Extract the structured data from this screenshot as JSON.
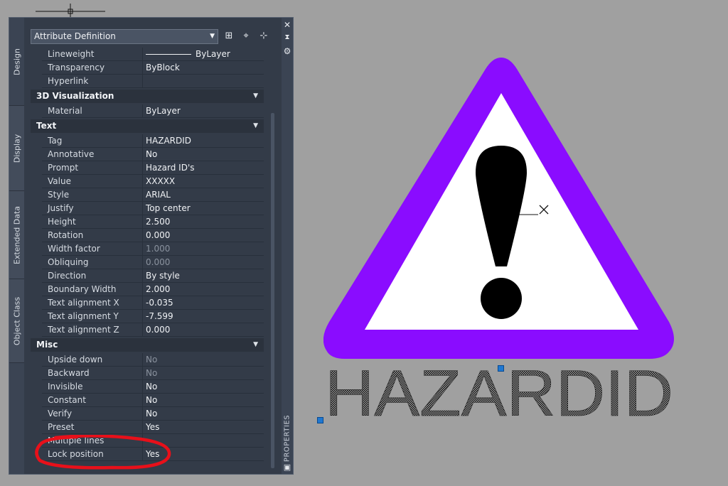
{
  "selector": {
    "value": "Attribute Definition"
  },
  "vertical_tabs": [
    "Design",
    "Display",
    "Extended Data",
    "Object Class"
  ],
  "right_bar_label": "PROPERTIES",
  "icons": {
    "close": "close-icon",
    "autohide": "autohide-icon",
    "settings": "settings-icon",
    "quick_select": "quick-select-icon",
    "select_objects": "select-objects-icon",
    "toggle_pickadd": "toggle-pickadd-icon",
    "properties_palette": "properties-palette-icon"
  },
  "sections": {
    "general_rows": [
      {
        "name": "Lineweight",
        "value": "ByLayer",
        "line": true
      },
      {
        "name": "Transparency",
        "value": "ByBlock"
      },
      {
        "name": "Hyperlink",
        "value": ""
      }
    ],
    "visualization": {
      "title": "3D Visualization",
      "rows": [
        {
          "name": "Material",
          "value": "ByLayer"
        }
      ]
    },
    "text": {
      "title": "Text",
      "rows": [
        {
          "name": "Tag",
          "value": "HAZARDID"
        },
        {
          "name": "Annotative",
          "value": "No"
        },
        {
          "name": "Prompt",
          "value": "Hazard ID's"
        },
        {
          "name": "Value",
          "value": "XXXXX"
        },
        {
          "name": "Style",
          "value": "ARIAL"
        },
        {
          "name": "Justify",
          "value": "Top center"
        },
        {
          "name": "Height",
          "value": "2.500"
        },
        {
          "name": "Rotation",
          "value": "0.000"
        },
        {
          "name": "Width factor",
          "value": "1.000",
          "dim": true
        },
        {
          "name": "Obliquing",
          "value": "0.000",
          "dim": true
        },
        {
          "name": "Direction",
          "value": "By style"
        },
        {
          "name": "Boundary Width",
          "value": "2.000"
        },
        {
          "name": "Text alignment X",
          "value": "-0.035"
        },
        {
          "name": "Text alignment Y",
          "value": "-7.599"
        },
        {
          "name": "Text alignment Z",
          "value": "0.000"
        }
      ]
    },
    "misc": {
      "title": "Misc",
      "rows": [
        {
          "name": "Upside down",
          "value": "No",
          "dim": true
        },
        {
          "name": "Backward",
          "value": "No",
          "dim": true
        },
        {
          "name": "Invisible",
          "value": "No"
        },
        {
          "name": "Constant",
          "value": "No"
        },
        {
          "name": "Verify",
          "value": "No"
        },
        {
          "name": "Preset",
          "value": "Yes"
        },
        {
          "name": "Multiple lines",
          "value": ""
        },
        {
          "name": "Lock position",
          "value": "Yes"
        }
      ]
    }
  },
  "drawing": {
    "attribute_tag": "HAZARDID",
    "colors": {
      "triangle_border": "#8a0cff",
      "triangle_fill": "#ffffff",
      "exclamation": "#000000",
      "background": "#a0a0a0",
      "grip": "#1f78d1",
      "annotation": "#e8101a"
    }
  }
}
